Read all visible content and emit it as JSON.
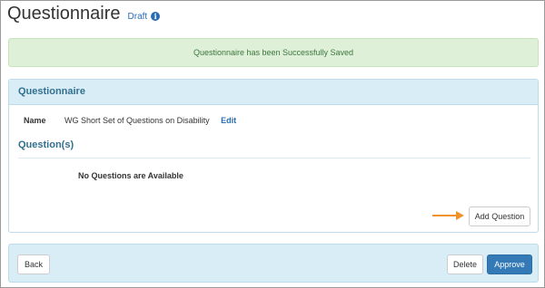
{
  "header": {
    "title": "Questionnaire",
    "status": "Draft",
    "info_icon": "info-circle-icon"
  },
  "alert": {
    "message": "Questionnaire has been Successfully Saved",
    "color": "#3c763d"
  },
  "panel": {
    "heading": "Questionnaire",
    "name_label": "Name",
    "name_value": "WG Short Set of Questions on Disability",
    "edit_label": "Edit",
    "questions_heading": "Question(s)",
    "empty_message": "No Questions are Available",
    "add_button_label": "Add Question",
    "arrow_icon": "arrow-right-icon",
    "arrow_color": "#f0922b"
  },
  "footer": {
    "back_label": "Back",
    "delete_label": "Delete",
    "approve_label": "Approve",
    "primary_color": "#337ab7"
  }
}
